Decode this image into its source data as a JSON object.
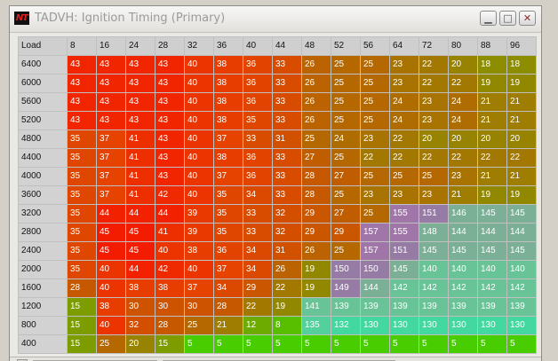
{
  "window": {
    "title": "TADVH: Ignition Timing (Primary)",
    "logo_text": "NT",
    "minimize_symbol": "▁",
    "maximize_symbol": "□",
    "close_symbol": "✕"
  },
  "table": {
    "corner_label": "Load",
    "columns": [
      "8",
      "16",
      "24",
      "28",
      "32",
      "36",
      "40",
      "44",
      "48",
      "52",
      "56",
      "64",
      "72",
      "80",
      "88",
      "96"
    ],
    "rows": [
      {
        "load": "6400",
        "values": [
          43,
          43,
          43,
          43,
          40,
          38,
          36,
          33,
          26,
          25,
          25,
          23,
          22,
          20,
          18,
          18
        ]
      },
      {
        "load": "6000",
        "values": [
          43,
          43,
          43,
          43,
          40,
          38,
          36,
          33,
          26,
          25,
          25,
          23,
          22,
          22,
          19,
          19
        ]
      },
      {
        "load": "5600",
        "values": [
          43,
          43,
          43,
          43,
          40,
          38,
          36,
          33,
          26,
          25,
          25,
          24,
          23,
          24,
          21,
          21
        ]
      },
      {
        "load": "5200",
        "values": [
          43,
          43,
          43,
          43,
          40,
          38,
          35,
          33,
          26,
          25,
          25,
          24,
          23,
          24,
          21,
          21
        ]
      },
      {
        "load": "4800",
        "values": [
          35,
          37,
          41,
          43,
          40,
          37,
          33,
          31,
          25,
          24,
          23,
          22,
          20,
          20,
          20,
          20
        ]
      },
      {
        "load": "4400",
        "values": [
          35,
          37,
          41,
          43,
          40,
          38,
          36,
          33,
          27,
          25,
          22,
          22,
          22,
          22,
          22,
          22
        ]
      },
      {
        "load": "4000",
        "values": [
          35,
          37,
          41,
          43,
          40,
          37,
          36,
          33,
          28,
          27,
          25,
          25,
          25,
          23,
          21,
          21
        ]
      },
      {
        "load": "3600",
        "values": [
          35,
          37,
          41,
          42,
          40,
          35,
          34,
          33,
          28,
          25,
          23,
          23,
          23,
          21,
          19,
          19
        ]
      },
      {
        "load": "3200",
        "values": [
          35,
          44,
          44,
          44,
          39,
          35,
          33,
          32,
          29,
          27,
          25,
          155,
          151,
          146,
          145,
          145
        ]
      },
      {
        "load": "2800",
        "values": [
          35,
          45,
          45,
          41,
          39,
          35,
          33,
          32,
          29,
          29,
          157,
          155,
          148,
          144,
          144,
          144
        ]
      },
      {
        "load": "2400",
        "values": [
          35,
          45,
          45,
          40,
          38,
          36,
          34,
          31,
          26,
          25,
          157,
          151,
          145,
          145,
          145,
          145
        ]
      },
      {
        "load": "2000",
        "values": [
          35,
          40,
          44,
          42,
          40,
          37,
          34,
          26,
          19,
          150,
          150,
          145,
          140,
          140,
          140,
          140
        ]
      },
      {
        "load": "1600",
        "values": [
          28,
          40,
          38,
          38,
          37,
          34,
          29,
          22,
          19,
          149,
          144,
          142,
          142,
          142,
          142,
          142
        ]
      },
      {
        "load": "1200",
        "values": [
          15,
          38,
          30,
          30,
          30,
          28,
          22,
          19,
          141,
          139,
          139,
          139,
          139,
          139,
          139,
          139
        ]
      },
      {
        "load": "800",
        "values": [
          15,
          40,
          32,
          28,
          25,
          21,
          12,
          8,
          135,
          132,
          130,
          130,
          130,
          130,
          130,
          130
        ]
      },
      {
        "load": "400",
        "values": [
          15,
          25,
          20,
          15,
          5,
          5,
          5,
          5,
          5,
          5,
          5,
          5,
          5,
          5,
          5,
          5
        ]
      }
    ]
  },
  "colors": {
    "header_bg": "#cfcfcf",
    "grid_line": "#c0c0c0",
    "cell_text": "#ffffff",
    "hot_red": "#f01c00",
    "orange": "#e64500",
    "olive": "#928800",
    "green": "#46d000",
    "teal": "#48d8a0",
    "purple": "#9a7aa8"
  }
}
